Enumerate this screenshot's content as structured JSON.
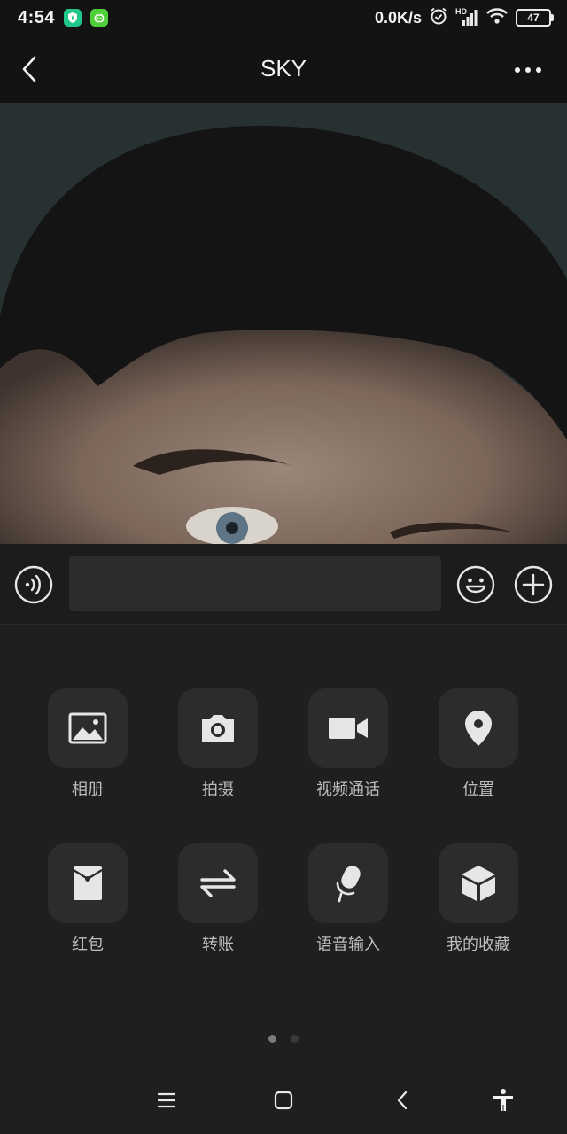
{
  "status_bar": {
    "time": "4:54",
    "net_speed": "0.0K/s",
    "network_label": "HD",
    "battery": "47",
    "icons": [
      "shield-app-icon",
      "android-app-icon",
      "alarm-icon",
      "signal-icon",
      "wifi-icon",
      "battery-icon"
    ]
  },
  "header": {
    "title": "SKY",
    "icons": [
      "back-arrow-icon",
      "more-dots-icon"
    ]
  },
  "input_bar": {
    "value": "",
    "placeholder": "",
    "icons": [
      "voice-icon",
      "emoji-icon",
      "plus-icon"
    ]
  },
  "panel": {
    "items": [
      {
        "label": "相册",
        "icon": "album-icon"
      },
      {
        "label": "拍摄",
        "icon": "camera-icon"
      },
      {
        "label": "视频通话",
        "icon": "video-call-icon"
      },
      {
        "label": "位置",
        "icon": "location-icon"
      },
      {
        "label": "红包",
        "icon": "red-packet-icon"
      },
      {
        "label": "转账",
        "icon": "transfer-icon"
      },
      {
        "label": "语音输入",
        "icon": "microphone-icon"
      },
      {
        "label": "我的收藏",
        "icon": "favorites-icon"
      }
    ],
    "pages": 2,
    "active_page": 1
  },
  "system_nav": {
    "icons": [
      "menu-icon",
      "home-icon",
      "back-icon",
      "accessibility-icon"
    ]
  },
  "colors": {
    "background": "#1f1f1f",
    "tile": "#2c2c2c",
    "topbar": "#131313",
    "app_badge_a": "#1fc78a",
    "app_badge_b": "#4fcf3a"
  }
}
